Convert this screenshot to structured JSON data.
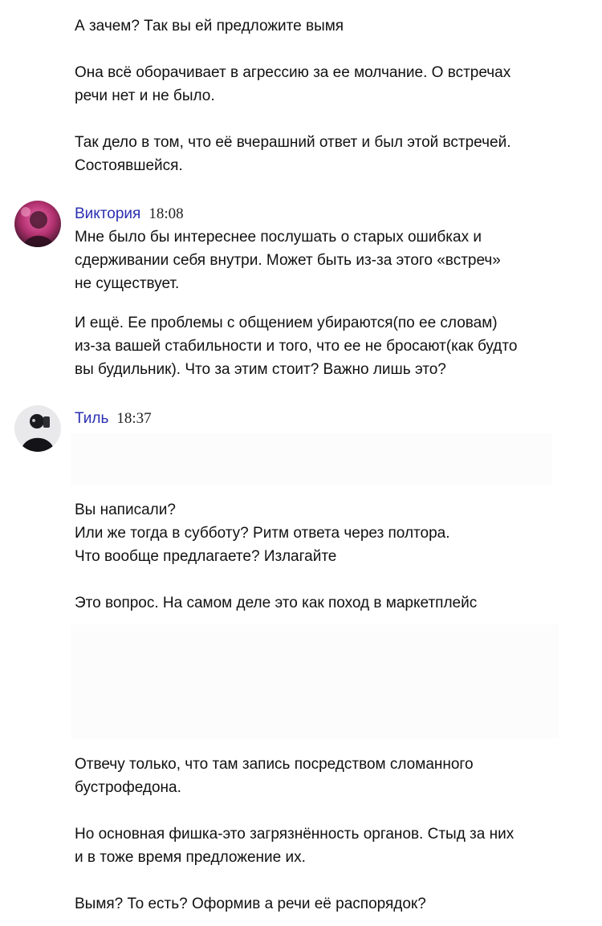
{
  "messages_top": [
    {
      "lines": [
        "А зачем? Так вы ей предложите вымя"
      ]
    },
    {
      "lines": [
        "Она всё оборачивает в агрессию за ее молчание. О встречах",
        "речи нет и не было."
      ]
    },
    {
      "lines": [
        "Так дело в том, что её вчерашний ответ и был этой встречей.",
        "Состоявшейся."
      ]
    }
  ],
  "posts": [
    {
      "author": "Виктория",
      "time": "18:08",
      "avatar_icon": "user-avatar-pink",
      "paragraphs": [
        [
          "Мне было бы интереснее послушать о старых ошибках и",
          "сдерживании себя внутри. Может быть из-за этого «встреч»",
          "не существует."
        ],
        [
          "И ещё. Ее проблемы с общением убираются(по ее словам)",
          "из-за вашей стабильности и того, что ее не бросают(как будто",
          "вы будильник). Что за этим стоит? Важно лишь это?"
        ]
      ]
    },
    {
      "author": "Тиль",
      "time": "18:37",
      "avatar_icon": "user-avatar-dark",
      "paragraphs": [
        [
          "Вы написали?",
          "Или же тогда в субботу? Ритм ответа через полтора.",
          "Что вообще предлагаете? Излагайте"
        ],
        [
          "Это вопрос. На самом деле это как поход в маркетплейс"
        ],
        [
          "Отвечу только, что там запись посредством сломанного",
          "бустрофедона."
        ],
        [
          "Но основная фишка-это загрязнённость органов. Стыд за них",
          "и в тоже время предложение их."
        ],
        [
          "Вымя? То есть? Оформив а речи её распорядок?"
        ]
      ]
    }
  ],
  "colors": {
    "author_name": "#2a2fb0",
    "text": "#111111",
    "background": "#ffffff"
  }
}
